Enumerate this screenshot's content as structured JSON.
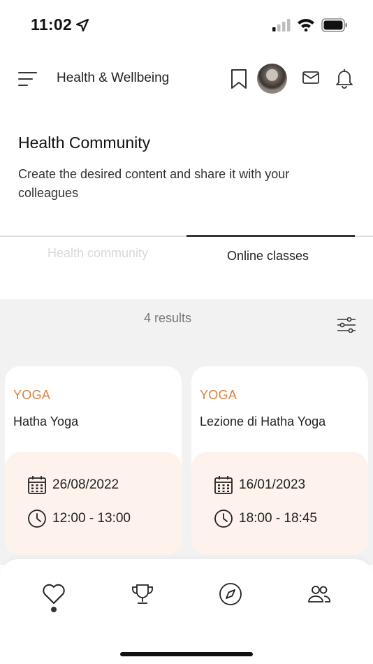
{
  "status_bar": {
    "time": "11:02"
  },
  "header": {
    "title": "Health & Wellbeing"
  },
  "page": {
    "title": "Health Community",
    "description": "Create the desired content and share it with your colleagues"
  },
  "tabs": [
    {
      "label": "Health community",
      "active": false
    },
    {
      "label": "Online classes",
      "active": true
    }
  ],
  "results": {
    "count_label": "4 results"
  },
  "cards": [
    {
      "category": "YOGA",
      "name": "Hatha Yoga",
      "date": "26/08/2022",
      "time": "12:00 - 13:00"
    },
    {
      "category": "YOGA",
      "name": "Lezione di Hatha Yoga",
      "date": "16/01/2023",
      "time": "18:00 - 18:45"
    }
  ],
  "bottom_nav": [
    {
      "icon": "heart-icon",
      "active": true
    },
    {
      "icon": "trophy-icon",
      "active": false
    },
    {
      "icon": "compass-icon",
      "active": false
    },
    {
      "icon": "people-icon",
      "active": false
    }
  ],
  "colors": {
    "accent": "#d9823f",
    "card_info_bg": "#fdf3ec",
    "content_bg": "#f2f2f2"
  }
}
